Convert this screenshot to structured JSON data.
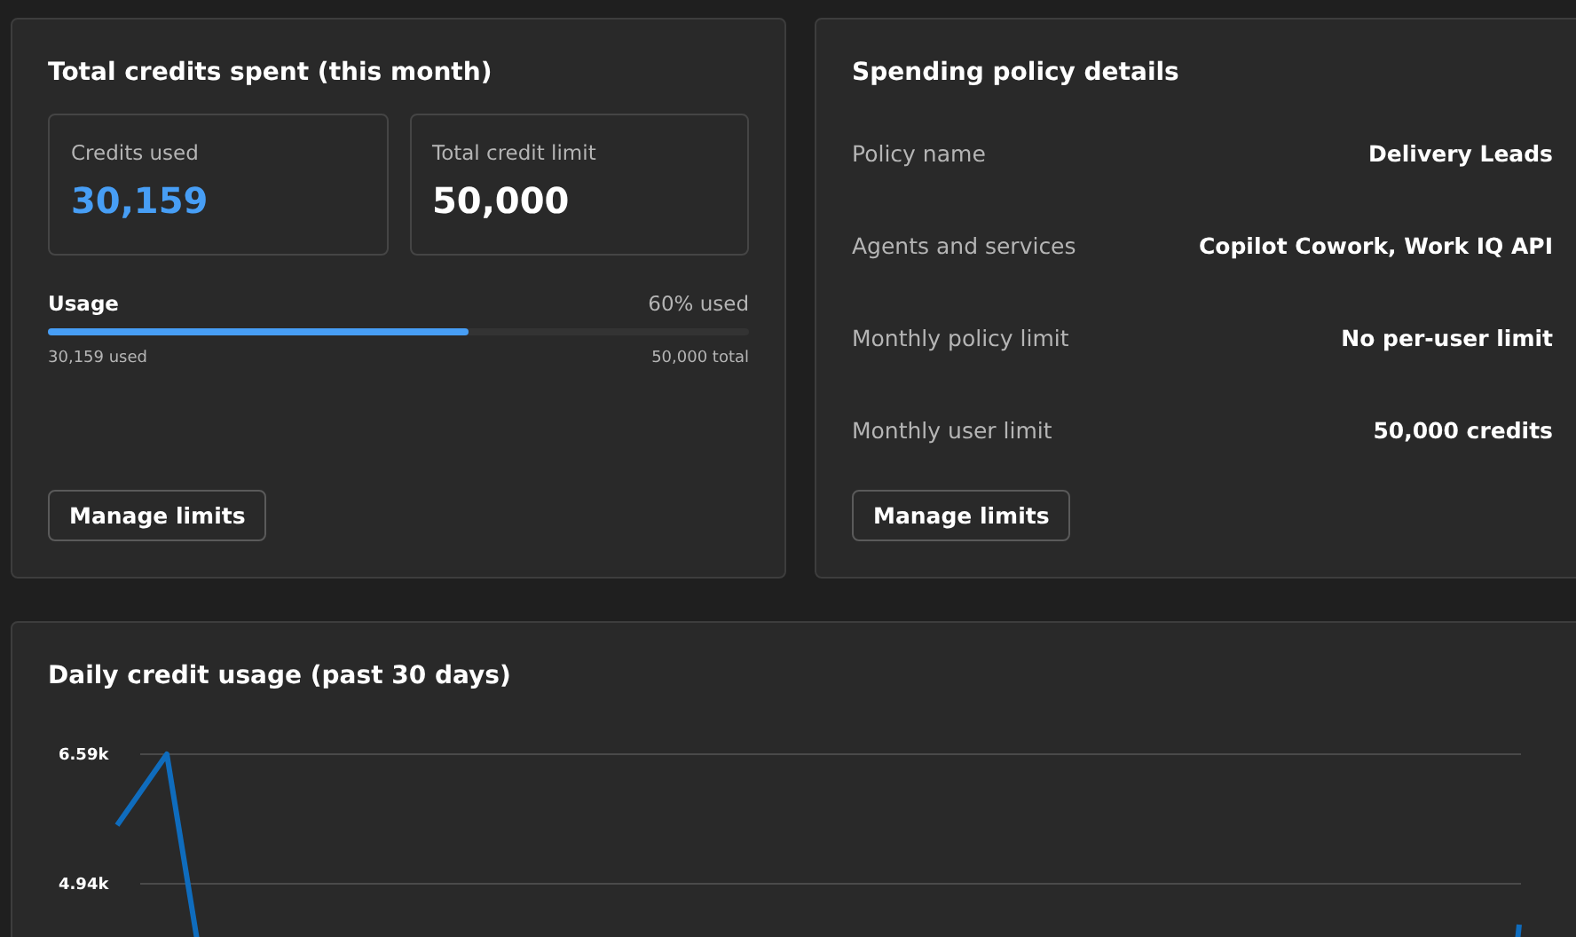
{
  "credits_card": {
    "title": "Total credits spent (this month)",
    "stats": [
      {
        "label": "Credits used",
        "value": "30,159",
        "kind": "accent"
      },
      {
        "label": "Total credit limit",
        "value": "50,000",
        "kind": "plain"
      }
    ],
    "usage": {
      "label": "Usage",
      "percent": "60% used",
      "level": 0.6,
      "used": "30,159 used",
      "total": "50,000 total"
    },
    "button": "Manage limits"
  },
  "policy_card": {
    "title": "Spending policy details",
    "rows": [
      {
        "label": "Policy name",
        "value": "Delivery Leads"
      },
      {
        "label": "Agents and services",
        "value": "Copilot Cowork, Work IQ API"
      },
      {
        "label": "Monthly policy limit",
        "value": "No per-user limit"
      },
      {
        "label": "Monthly user limit",
        "value": "50,000 credits"
      }
    ],
    "button": "Manage limits"
  },
  "daily_usage": {
    "title": "Daily credit usage (past 30 days)",
    "axis_labels": [
      "6.59k",
      "4.94k"
    ]
  }
}
